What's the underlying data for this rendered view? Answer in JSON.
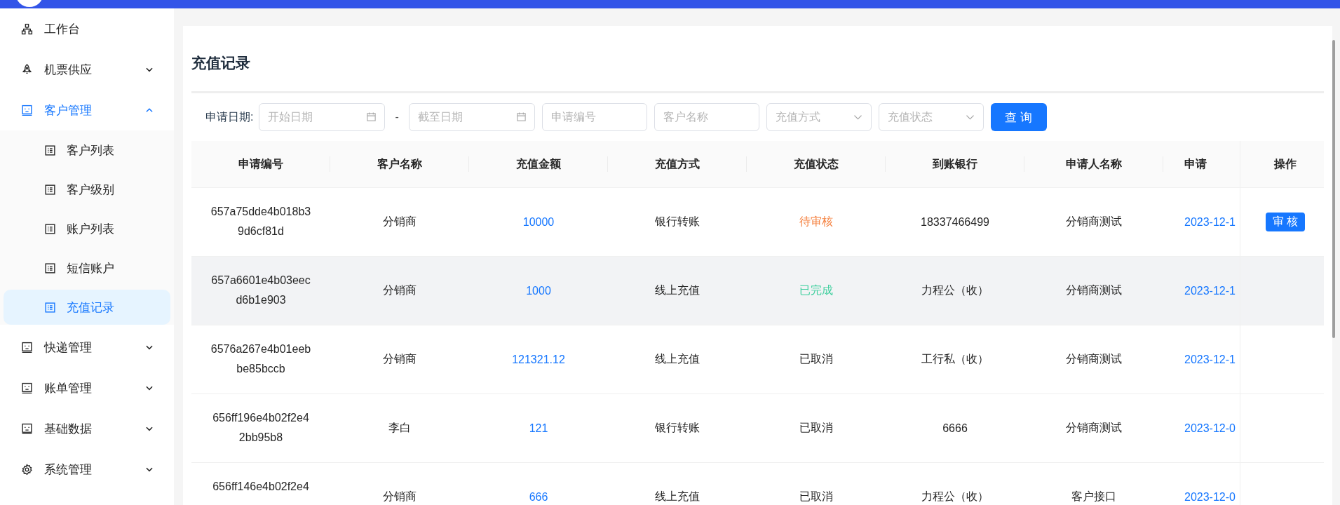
{
  "sidebar": {
    "items": [
      {
        "label": "工作台",
        "kind": "sitemap",
        "expandable": false
      },
      {
        "label": "机票供应",
        "kind": "rocket",
        "expandable": true,
        "expanded": false
      },
      {
        "label": "客户管理",
        "kind": "panel",
        "expandable": true,
        "expanded": true,
        "children": [
          {
            "label": "客户列表",
            "selected": false
          },
          {
            "label": "客户级别",
            "selected": false
          },
          {
            "label": "账户列表",
            "selected": false
          },
          {
            "label": "短信账户",
            "selected": false
          },
          {
            "label": "充值记录",
            "selected": true
          }
        ]
      },
      {
        "label": "快递管理",
        "kind": "panel",
        "expandable": true,
        "expanded": false
      },
      {
        "label": "账单管理",
        "kind": "panel",
        "expandable": true,
        "expanded": false
      },
      {
        "label": "基础数据",
        "kind": "panel",
        "expandable": true,
        "expanded": false
      },
      {
        "label": "系统管理",
        "kind": "gear",
        "expandable": true,
        "expanded": false
      }
    ]
  },
  "page": {
    "title": "充值记录",
    "filter": {
      "label": "申请日期:",
      "fields": [
        {
          "kind": "date",
          "placeholder": "开始日期"
        },
        {
          "kind": "separator",
          "text": "-"
        },
        {
          "kind": "date",
          "placeholder": "截至日期"
        },
        {
          "kind": "text",
          "placeholder": "申请编号"
        },
        {
          "kind": "text",
          "placeholder": "客户名称"
        },
        {
          "kind": "select",
          "placeholder": "充值方式"
        },
        {
          "kind": "select",
          "placeholder": "充值状态"
        }
      ],
      "button": "查 询"
    },
    "table": {
      "columns": [
        "申请编号",
        "客户名称",
        "充值金额",
        "充值方式",
        "充值状态",
        "到账银行",
        "申请人名称",
        "申请"
      ],
      "action_column": "操作",
      "rows": [
        {
          "id": "657a75dde4b018b39d6cf81d",
          "customer": "分销商",
          "amount": "10000",
          "method": "银行转账",
          "status": {
            "text": "待审核",
            "color": "#f5803e"
          },
          "bank": "18337466499",
          "applicant": "分销商测试",
          "date": "2023-12-1",
          "highlighted": false,
          "action": "审 核"
        },
        {
          "id": "657a6601e4b03eecd6b1e903",
          "customer": "分销商",
          "amount": "1000",
          "method": "线上充值",
          "status": {
            "text": "已完成",
            "color": "#3fcf9e"
          },
          "bank": "力程公（收）",
          "applicant": "分销商测试",
          "date": "2023-12-1",
          "highlighted": true
        },
        {
          "id": "6576a267e4b01eebbe85bccb",
          "customer": "分销商",
          "amount": "121321.12",
          "method": "线上充值",
          "status": {
            "text": "已取消",
            "color": "#262626"
          },
          "bank": "工行私（收）",
          "applicant": "分销商测试",
          "date": "2023-12-1",
          "highlighted": false
        },
        {
          "id": "656ff196e4b02f2e42bb95b8",
          "customer": "李白",
          "amount": "121",
          "method": "银行转账",
          "status": {
            "text": "已取消",
            "color": "#262626"
          },
          "bank": "6666",
          "applicant": "分销商测试",
          "date": "2023-12-0",
          "highlighted": false
        },
        {
          "id": "656ff146e4b02f2e4",
          "customer": "分销商",
          "amount": "666",
          "method": "线上充值",
          "status": {
            "text": "已取消",
            "color": "#262626"
          },
          "bank": "力程公（收）",
          "applicant": "客户接口",
          "date": "2023-12-0",
          "highlighted": false
        }
      ]
    }
  }
}
